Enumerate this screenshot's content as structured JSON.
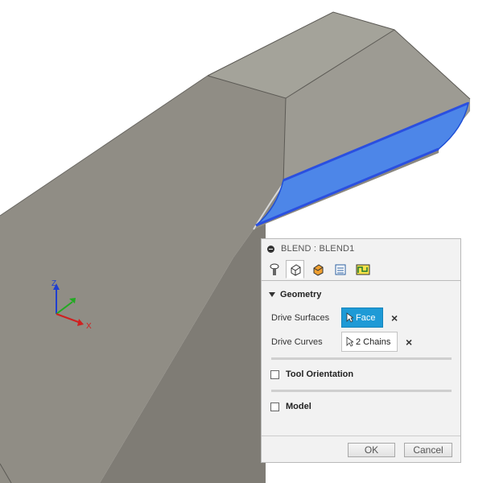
{
  "viewport": {
    "axis": {
      "z_label": "Z",
      "x_label": "X"
    },
    "colors": {
      "body_light": "#a6a59c",
      "body_mid": "#908d85",
      "body_dark": "#7d7a73",
      "selection": "#2f63e0"
    }
  },
  "panel": {
    "title": "BLEND : BLEND1",
    "tabs": [
      {
        "icon": "tool-icon",
        "active": false
      },
      {
        "icon": "geometry-icon",
        "active": true
      },
      {
        "icon": "heights-icon",
        "active": false
      },
      {
        "icon": "passes-icon",
        "active": false
      },
      {
        "icon": "linking-icon",
        "active": false
      }
    ],
    "geometry": {
      "heading": "Geometry",
      "drive_surfaces": {
        "label": "Drive Surfaces",
        "value": "Face"
      },
      "drive_curves": {
        "label": "Drive Curves",
        "value": "2 Chains"
      }
    },
    "tool_orientation": {
      "label": "Tool Orientation",
      "checked": false
    },
    "model": {
      "label": "Model",
      "checked": false
    },
    "buttons": {
      "ok": "OK",
      "cancel": "Cancel"
    }
  }
}
